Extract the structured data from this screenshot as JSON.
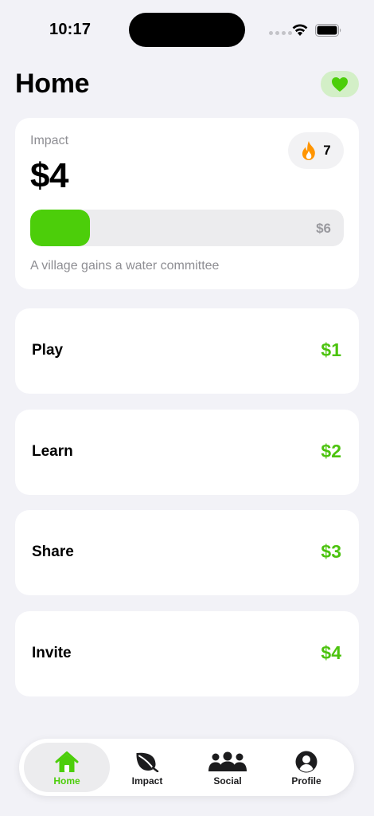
{
  "status_bar": {
    "time": "10:17"
  },
  "header": {
    "title": "Home"
  },
  "impact": {
    "label": "Impact",
    "amount": "$4",
    "streak_count": "7",
    "progress_fraction": 0.19,
    "goal": "$6",
    "message": "A village gains a water committee"
  },
  "actions": [
    {
      "label": "Play",
      "reward": "$1"
    },
    {
      "label": "Learn",
      "reward": "$2"
    },
    {
      "label": "Share",
      "reward": "$3"
    },
    {
      "label": "Invite",
      "reward": "$4"
    }
  ],
  "tabs": [
    {
      "label": "Home",
      "icon": "home-icon",
      "active": true
    },
    {
      "label": "Impact",
      "icon": "leaf-icon",
      "active": false
    },
    {
      "label": "Social",
      "icon": "people-icon",
      "active": false
    },
    {
      "label": "Profile",
      "icon": "profile-icon",
      "active": false
    }
  ],
  "colors": {
    "accent": "#4cce0a",
    "reward": "#4cc30e",
    "background": "#f2f2f7",
    "streak": "#ff9500"
  }
}
